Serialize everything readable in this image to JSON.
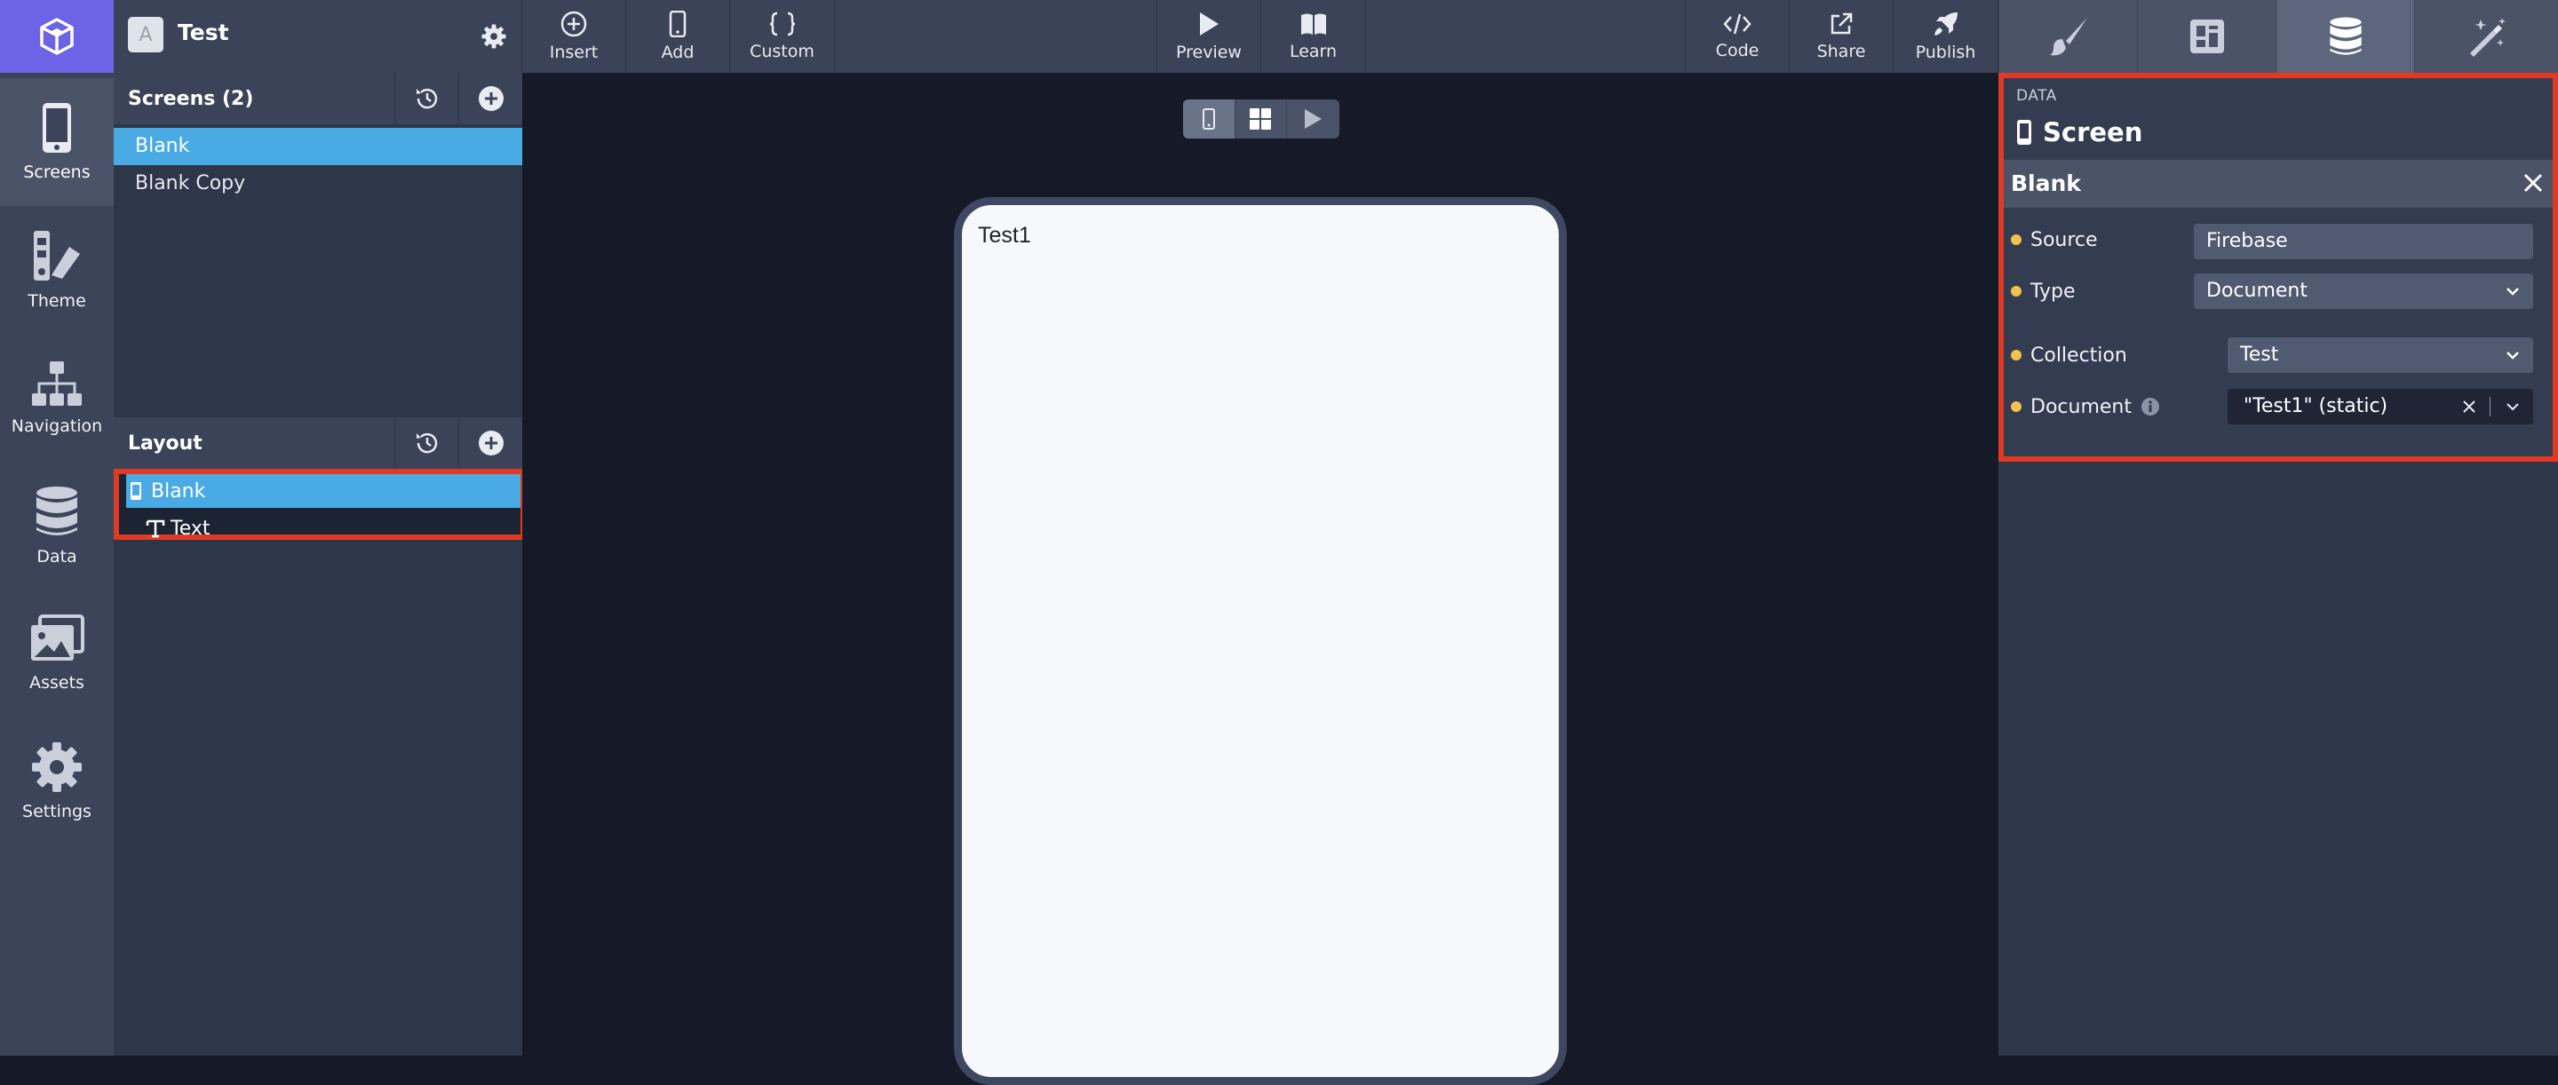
{
  "rail": {
    "items": [
      {
        "label": "Screens",
        "icon": "phone-icon"
      },
      {
        "label": "Theme",
        "icon": "palette-icon"
      },
      {
        "label": "Navigation",
        "icon": "sitemap-icon"
      },
      {
        "label": "Data",
        "icon": "database-icon"
      },
      {
        "label": "Assets",
        "icon": "images-icon"
      },
      {
        "label": "Settings",
        "icon": "gear-icon"
      }
    ],
    "active": "Screens"
  },
  "project": {
    "avatar_letter": "A",
    "name": "Test"
  },
  "toolbar": {
    "insert": "Insert",
    "add": "Add",
    "custom": "Custom",
    "preview": "Preview",
    "learn": "Learn",
    "code": "Code",
    "share": "Share",
    "publish": "Publish"
  },
  "screens": {
    "title": "Screens (2)",
    "items": [
      "Blank",
      "Blank Copy"
    ],
    "selected": "Blank"
  },
  "layout": {
    "title": "Layout",
    "items": [
      {
        "label": "Blank",
        "icon": "phone-icon"
      },
      {
        "label": "Text",
        "icon": "text-icon"
      }
    ]
  },
  "canvas": {
    "phone_text": "Test1"
  },
  "data_panel": {
    "tag": "DATA",
    "header": "Screen",
    "screen_name": "Blank",
    "fields": {
      "source_label": "Source",
      "source_value": "Firebase",
      "type_label": "Type",
      "type_value": "Document",
      "collection_label": "Collection",
      "collection_value": "Test",
      "document_label": "Document",
      "document_value": "\"Test1\" (static)"
    }
  },
  "colors": {
    "accent": "#6c63e6",
    "selection": "#4aaae3",
    "highlight_box": "#e03a24",
    "required_dot": "#f2c14e"
  }
}
